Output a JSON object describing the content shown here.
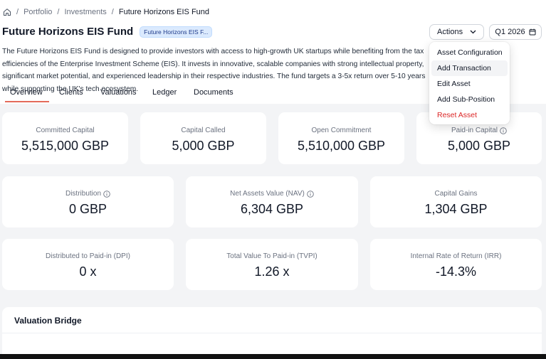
{
  "breadcrumb": {
    "home_icon": "home-icon",
    "items": [
      "Portfolio",
      "Investments",
      "Future Horizons EIS Fund"
    ]
  },
  "page": {
    "title": "Future Horizons EIS Fund",
    "badge": "Future Horizons EIS F...",
    "description": "The Future Horizons EIS Fund is designed to provide investors with access to high-growth UK startups while benefiting from the tax efficiencies of the Enterprise Investment Scheme (EIS). It invests in innovative, scalable companies with strong intellectual property, significant market potential, and experienced leadership in their respective industries. The fund targets a 3-5x return over 5-10 years while supporting the UK's tech ecosystem."
  },
  "toolbar": {
    "actions_label": "Actions",
    "period_label": "Q1 2026"
  },
  "actions_menu": {
    "items": [
      "Asset Configuration",
      "Add Transaction",
      "Edit Asset",
      "Add Sub-Position",
      "Reset Asset"
    ]
  },
  "tabs": [
    "Overview",
    "Clients",
    "Valuations",
    "Ledger",
    "Documents"
  ],
  "active_tab": "Overview",
  "metrics_row1": [
    {
      "label": "Committed Capital",
      "value": "5,515,000 GBP"
    },
    {
      "label": "Capital Called",
      "value": "5,000 GBP"
    },
    {
      "label": "Open Commitment",
      "value": "5,510,000 GBP"
    },
    {
      "label": "Paid-in Capital",
      "value": "5,000 GBP"
    }
  ],
  "metrics_row2": [
    {
      "label": "Distribution",
      "value": "0 GBP"
    },
    {
      "label": "Net Assets Value (NAV)",
      "value": "6,304 GBP"
    },
    {
      "label": "Capital Gains",
      "value": "1,304 GBP"
    }
  ],
  "metrics_row3": [
    {
      "label": "Distributed to Paid-in (DPI)",
      "value": "0 x"
    },
    {
      "label": "Total Value To Paid-in (TVPI)",
      "value": "1.26 x"
    },
    {
      "label": "Internal Rate of Return (IRR)",
      "value": "-14.3%"
    }
  ],
  "valuation_bridge": {
    "title": "Valuation Bridge"
  },
  "colors": {
    "accent": "#e46b5a",
    "danger": "#dc2626",
    "badge_bg": "#dbeafe",
    "content_bg": "#f3f4f6"
  }
}
